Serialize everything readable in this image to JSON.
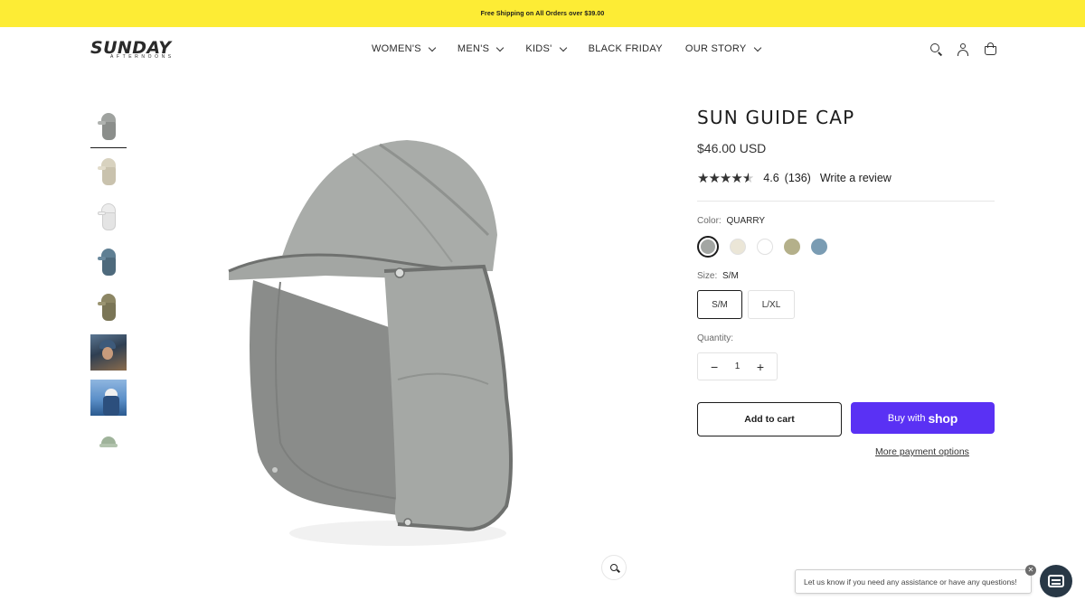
{
  "announcement": {
    "text": "Free Shipping on All Orders over $39.00"
  },
  "brand": {
    "name": "SUNDAY",
    "tagline": "AFTERNOONS",
    "accent_color": "#fdec35"
  },
  "nav": {
    "items": [
      {
        "label": "WOMEN'S",
        "has_dropdown": true
      },
      {
        "label": "MEN'S",
        "has_dropdown": true
      },
      {
        "label": "KIDS'",
        "has_dropdown": true
      },
      {
        "label": "BLACK FRIDAY",
        "has_dropdown": false
      },
      {
        "label": "OUR STORY",
        "has_dropdown": true
      }
    ],
    "icons": [
      "search-icon",
      "account-icon",
      "cart-icon"
    ]
  },
  "gallery": {
    "thumbnails": [
      "quarry",
      "sand",
      "white",
      "blue",
      "olive",
      "lifestyle-1",
      "lifestyle-2",
      "green"
    ],
    "selected_index": 0,
    "zoom_icon": "zoom-icon"
  },
  "product": {
    "title": "SUN GUIDE CAP",
    "price": "$46.00 USD",
    "rating": {
      "value": "4.6",
      "count": "(136)",
      "stars": 4.6,
      "write_review": "Write a review"
    },
    "color": {
      "label": "Color:",
      "selected": "QUARRY",
      "swatches": [
        "#a3a6a3",
        "#ebe6d7",
        "#ffffff",
        "#b4b08a",
        "#7a9cb3"
      ]
    },
    "size": {
      "label": "Size:",
      "selected": "S/M",
      "options": [
        "S/M",
        "L/XL"
      ]
    },
    "quantity": {
      "label": "Quantity:",
      "value": "1",
      "minus": "−",
      "plus": "+"
    },
    "add_to_cart": "Add to cart",
    "buy_with": "Buy with",
    "buy_brand": "shop",
    "buy_color": "#5a31f4",
    "more_payment": "More payment options"
  },
  "chat": {
    "message": "Let us know if you need any assistance or have any questions!",
    "close_icon": "close-icon",
    "launcher_icon": "chat-icon",
    "launcher_color": "#283846"
  }
}
